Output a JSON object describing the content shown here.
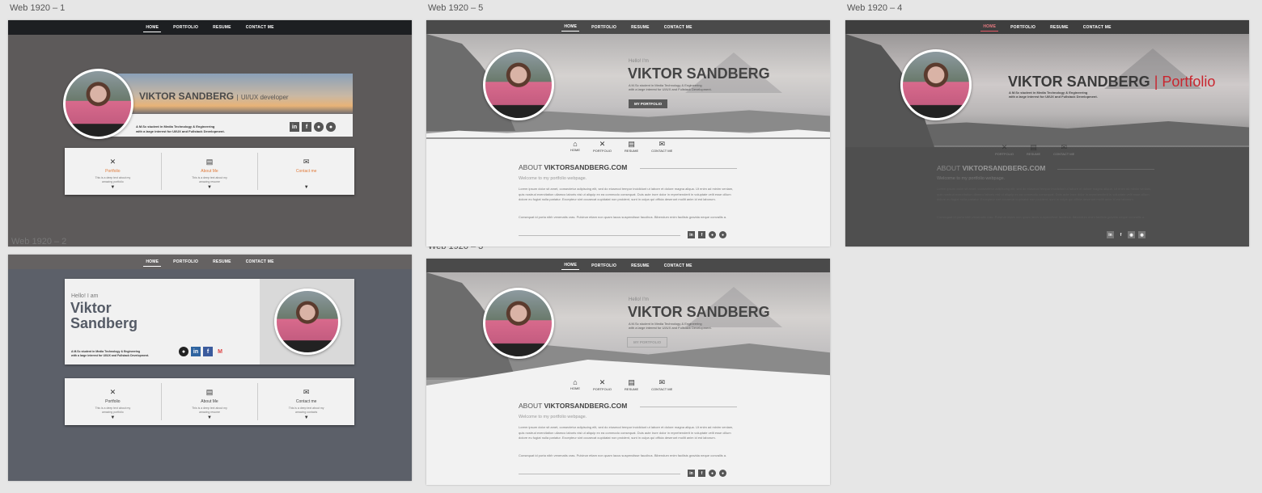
{
  "artboards": {
    "ab1": "Web 1920 – 1",
    "ab2": "Web 1920 – 2",
    "ab3": "Web 1920 – 3",
    "ab4": "Web 1920 – 4",
    "ab5": "Web 1920 – 5"
  },
  "nav": {
    "home": "HOME",
    "portfolio": "PORTFOLIO",
    "resume": "RESUME",
    "contact": "CONTACT ME"
  },
  "profile": {
    "name": "VIKTOR SANDBERG",
    "separator": "|",
    "role": "UI/UX developer",
    "portfolio_word": "Portfolio",
    "hello": "Hello! I'm",
    "hello_am": "Hello! I am",
    "first": "Viktor",
    "last": "Sandberg",
    "desc_line1": "A M.Sc student in Media Technology & Engineering",
    "desc_line2": "with a large interest for UI/UX and Fullstack Development."
  },
  "cards": {
    "portfolio": "Portfolio",
    "about": "About Me",
    "contact": "Contact me",
    "contact_cap": "Contact me",
    "small_portfolio": "This is a deep text about my amazing portfolio",
    "small_about": "This is a deep text about my amazing resume",
    "small_contact": "This is a deep text about my amazing contacts"
  },
  "section_icons": {
    "home": "HOME",
    "portfolio": "PORTFOLIO",
    "resume": "RESUME",
    "contact": "CONTACT ME"
  },
  "button": "MY PORTFOLIO",
  "about": {
    "prefix": "ABOUT",
    "site": "VIKTORSANDBERG.COM",
    "welcome": "Welcome to my portfolio webpage.",
    "p1": "Lorem ipsum dolor sit amet, consectetur adipiscing elit, sed do eiusmod tempor incididunt ut labore et dolore magna aliqua. Ut enim ad minim veniam, quis nostrud exercitation ullamco laboris nisi ut aliquip ex ea commodo consequat. Duis aute irure dolor in reprehenderit in voluptate velit esse cillum dolore eu fugiat nulla pariatur. Excepteur sint occaecat cupidatat non proident, sunt in culpa qui officia deserunt mollit anim id est laborum.",
    "p2": "Consequat id porta nibh venenatis cras. Pulvinar etiam non quam lacus suspendisse faucibus. Bibendum enim facilisis gravida neque convallis a."
  },
  "social": {
    "linkedin": "in",
    "facebook": "f"
  }
}
